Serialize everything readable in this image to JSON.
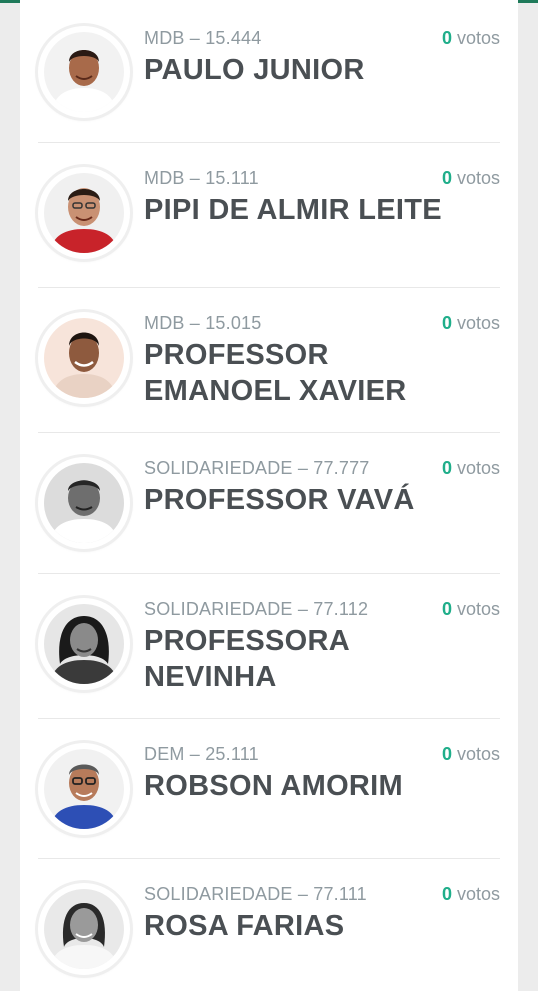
{
  "candidates": [
    {
      "party": "MDB – 15.444",
      "name": "PAULO JUNIOR",
      "votes_count": "0",
      "votes_label": "votos"
    },
    {
      "party": "MDB – 15.111",
      "name": "PIPI DE ALMIR LEITE",
      "votes_count": "0",
      "votes_label": "votos"
    },
    {
      "party": "MDB – 15.015",
      "name": "PROFESSOR EMANOEL XAVIER",
      "votes_count": "0",
      "votes_label": "votos"
    },
    {
      "party": "SOLIDARIEDADE – 77.777",
      "name": "PROFESSOR VAVÁ",
      "votes_count": "0",
      "votes_label": "votos"
    },
    {
      "party": "SOLIDARIEDADE – 77.112",
      "name": "PROFESSORA NEVINHA",
      "votes_count": "0",
      "votes_label": "votos"
    },
    {
      "party": "DEM – 25.111",
      "name": "ROBSON AMORIM",
      "votes_count": "0",
      "votes_label": "votos"
    },
    {
      "party": "SOLIDARIEDADE – 77.111",
      "name": "ROSA FARIAS",
      "votes_count": "0",
      "votes_label": "votos"
    }
  ],
  "colors": {
    "accent": "#1fae8a",
    "muted": "#8f9aa0",
    "name": "#4a4f53",
    "topbar": "#1f7a5a"
  }
}
